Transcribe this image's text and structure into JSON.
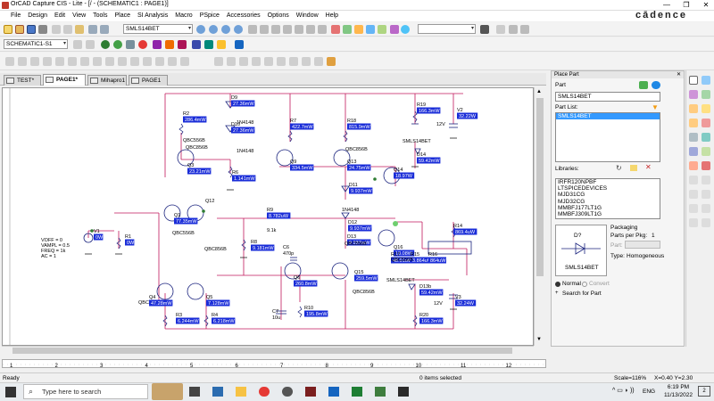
{
  "app": {
    "title": "OrCAD Capture CIS - Lite - [/ - (SCHEMATIC1 : PAGE1)]",
    "brand": "cādence"
  },
  "window_controls": [
    "—",
    "❐",
    "✕"
  ],
  "menu": [
    "File",
    "Design",
    "Edit",
    "View",
    "Tools",
    "Place",
    "SI Analysis",
    "Macro",
    "PSpice",
    "Accessories",
    "Options",
    "Window",
    "Help"
  ],
  "toolbar": {
    "part_combo": "SMLS14BET",
    "search_combo": "",
    "schematic_combo": "SCHEMATIC1-S1"
  },
  "tabs": [
    {
      "label": "TEST*",
      "active": false
    },
    {
      "label": "PAGE1*",
      "active": true
    },
    {
      "label": "Mihapro1",
      "active": false
    },
    {
      "label": "PAGE1",
      "active": false
    }
  ],
  "schematic": {
    "parts": [
      {
        "ref": "D9",
        "value": "27.36mW"
      },
      {
        "ref": "1N4148",
        "value": ""
      },
      {
        "ref": "D10",
        "value": "27.36mW"
      },
      {
        "ref": "R2",
        "value": "286.4mW"
      },
      {
        "ref": "R7",
        "value": "422.7mW"
      },
      {
        "ref": "R18",
        "value": "815.9mW"
      },
      {
        "ref": "R19",
        "value": "166.3mW"
      },
      {
        "ref": "V2",
        "value": "32.22W"
      },
      {
        "ref": "Q3",
        "value": "23.21mW"
      },
      {
        "ref": "R6",
        "value": "1.141mW"
      },
      {
        "ref": "Q9",
        "value": "334.5mW"
      },
      {
        "ref": "Q13",
        "value": "24.75mW"
      },
      {
        "ref": "Q14",
        "value": "18.97W"
      },
      {
        "ref": "D14",
        "value": "59.42mW"
      },
      {
        "ref": "D11",
        "value": "9.937mW"
      },
      {
        "ref": "Q1",
        "value": "77.35mW"
      },
      {
        "ref": "Q12",
        "value": ""
      },
      {
        "ref": "R9",
        "value": "8.782uW"
      },
      {
        "ref": "D12",
        "value": "9.937mW"
      },
      {
        "ref": "R14",
        "value": "869.4uW"
      },
      {
        "ref": "V1",
        "value": "0W"
      },
      {
        "ref": "R1",
        "value": "0W"
      },
      {
        "ref": "R8",
        "value": "9.181mW"
      },
      {
        "ref": "D13",
        "value": "9.937mW"
      },
      {
        "ref": "Q16",
        "value": "18.08W"
      },
      {
        "ref": "R17",
        "value": "48.01uW"
      },
      {
        "ref": "R15",
        "value": "3.864uW"
      },
      {
        "ref": "R16",
        "value": "864uW"
      },
      {
        "ref": "C6",
        "value": "470p"
      },
      {
        "ref": "Q4",
        "value": "47.28mW"
      },
      {
        "ref": "Q5",
        "value": "7.128mW"
      },
      {
        "ref": "Q6",
        "value": "260.8mW"
      },
      {
        "ref": "Q15",
        "value": "259.5mW"
      },
      {
        "ref": "D13b",
        "value": "59.42mW"
      },
      {
        "ref": "V3",
        "value": "32.24W"
      },
      {
        "ref": "C7",
        "value": "10u"
      },
      {
        "ref": "R10",
        "value": "195.8mW"
      },
      {
        "ref": "R3",
        "value": "6.244mW"
      },
      {
        "ref": "R4",
        "value": "6.218mW"
      },
      {
        "ref": "R20",
        "value": "166.3mW"
      }
    ],
    "labels": {
      "source_params": [
        "VOFF = 0",
        "VAMPL = 0.5",
        "FREQ = 1k",
        "AC = 1"
      ],
      "v2_volts": "12V",
      "v3_volts": "12V",
      "smls_top": "SMLS14BET",
      "smls_bottom": "SMLS14BET",
      "qbc_a": "QBC856B",
      "qbc_b": "QBC856B",
      "qbc_c": "QBC556B",
      "qbc_d": "QBC856B",
      "r9_sub": "9.1k",
      "diode_1n4148a": "1N4148",
      "diode_1n4148b": "1N4148",
      "diode_1n4148c": "1N4148",
      "qbc_e": "QBC556B",
      "qbc_f": "QBC856B",
      "qbc_g": "QBC556B",
      "qbc_h": "QBC556B",
      "qbc_q4": "QBC"
    }
  },
  "ruler": [
    "1",
    "2",
    "3",
    "4",
    "5",
    "6",
    "7",
    "8",
    "9",
    "10",
    "11",
    "12"
  ],
  "place_part": {
    "title": "Place Part",
    "part_label": "Part",
    "part_value": "SMLS14BET",
    "part_list_label": "Part List:",
    "part_list": [
      "SMLS14BET"
    ],
    "libraries_label": "Libraries:",
    "libraries": [
      "IRFR120NPBF",
      "LTSPICEDEVICES",
      "MJD31CG",
      "MJD32CG",
      "MMBFJ177LT1G",
      "MMBFJ309LT1G"
    ],
    "preview_ref": "D?",
    "preview_name": "SMLS14BET",
    "packaging_label": "Packaging",
    "parts_per_pkg_label": "Parts per Pkg:",
    "parts_per_pkg": "1",
    "part_field_label": "Part:",
    "type_label": "Type:",
    "type_value": "Homogeneous",
    "radio_normal": "Normal",
    "radio_convert": "Convert",
    "search_for_part": "Search for Part"
  },
  "status": {
    "left": "Ready",
    "center": "0 items selected",
    "scale": "Scale=116%",
    "coords": "X=0.40  Y=2.30"
  },
  "taskbar": {
    "search_placeholder": "Type here to search",
    "lang": "ENG",
    "time": "6:19 PM",
    "date": "11/13/2022",
    "notifications": "2"
  },
  "colors": {
    "wire": "#c2185b",
    "part_outline": "#1a237e",
    "value_box": "#1a2dd8",
    "selection": "#3399ff"
  }
}
